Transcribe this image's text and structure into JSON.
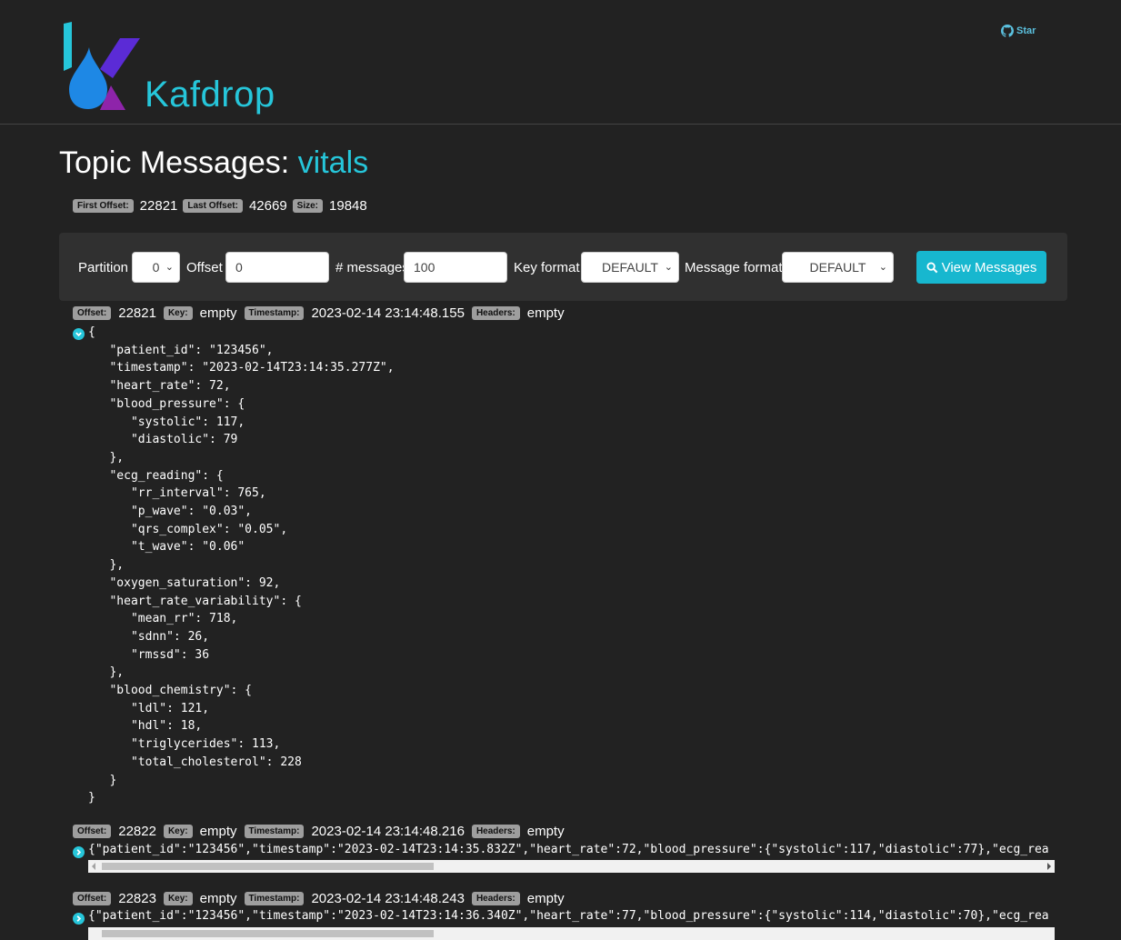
{
  "navbar": {
    "brand": "Kafdrop",
    "star_label": "Star"
  },
  "page": {
    "title_prefix": "Topic Messages: ",
    "topic": "vitals"
  },
  "summary": [
    {
      "label": "First Offset:",
      "value": "22821"
    },
    {
      "label": "Last Offset:",
      "value": "42669"
    },
    {
      "label": "Size:",
      "value": "19848"
    }
  ],
  "toolbar": {
    "partition_label": "Partition",
    "partition_value": "0",
    "offset_label": "Offset",
    "offset_value": "0",
    "count_label": "# messages",
    "count_value": "100",
    "key_format_label": "Key format",
    "key_format_value": "DEFAULT",
    "message_format_label": "Message format",
    "message_format_value": "DEFAULT",
    "view_button": "View Messages"
  },
  "meta_labels": {
    "offset": "Offset:",
    "key": "Key:",
    "timestamp": "Timestamp:",
    "headers": "Headers:"
  },
  "messages": [
    {
      "offset": "22821",
      "key": "empty",
      "timestamp": "2023-02-14 23:14:48.155",
      "headers": "empty",
      "expanded": true,
      "body": "{\n   \"patient_id\": \"123456\",\n   \"timestamp\": \"2023-02-14T23:14:35.277Z\",\n   \"heart_rate\": 72,\n   \"blood_pressure\": {\n      \"systolic\": 117,\n      \"diastolic\": 79\n   },\n   \"ecg_reading\": {\n      \"rr_interval\": 765,\n      \"p_wave\": \"0.03\",\n      \"qrs_complex\": \"0.05\",\n      \"t_wave\": \"0.06\"\n   },\n   \"oxygen_saturation\": 92,\n   \"heart_rate_variability\": {\n      \"mean_rr\": 718,\n      \"sdnn\": 26,\n      \"rmssd\": 36\n   },\n   \"blood_chemistry\": {\n      \"ldl\": 121,\n      \"hdl\": 18,\n      \"triglycerides\": 113,\n      \"total_cholesterol\": 228\n   }\n}"
    },
    {
      "offset": "22822",
      "key": "empty",
      "timestamp": "2023-02-14 23:14:48.216",
      "headers": "empty",
      "expanded": false,
      "body": "{\"patient_id\":\"123456\",\"timestamp\":\"2023-02-14T23:14:35.832Z\",\"heart_rate\":72,\"blood_pressure\":{\"systolic\":117,\"diastolic\":77},\"ecg_rea"
    },
    {
      "offset": "22823",
      "key": "empty",
      "timestamp": "2023-02-14 23:14:48.243",
      "headers": "empty",
      "expanded": false,
      "body": "{\"patient_id\":\"123456\",\"timestamp\":\"2023-02-14T23:14:36.340Z\",\"heart_rate\":77,\"blood_pressure\":{\"systolic\":114,\"diastolic\":70},\"ecg_rea"
    }
  ],
  "colors": {
    "background": "#222222",
    "accent": "#26c6da",
    "button": "#17b7cf",
    "badge": "#9e9e9e"
  }
}
